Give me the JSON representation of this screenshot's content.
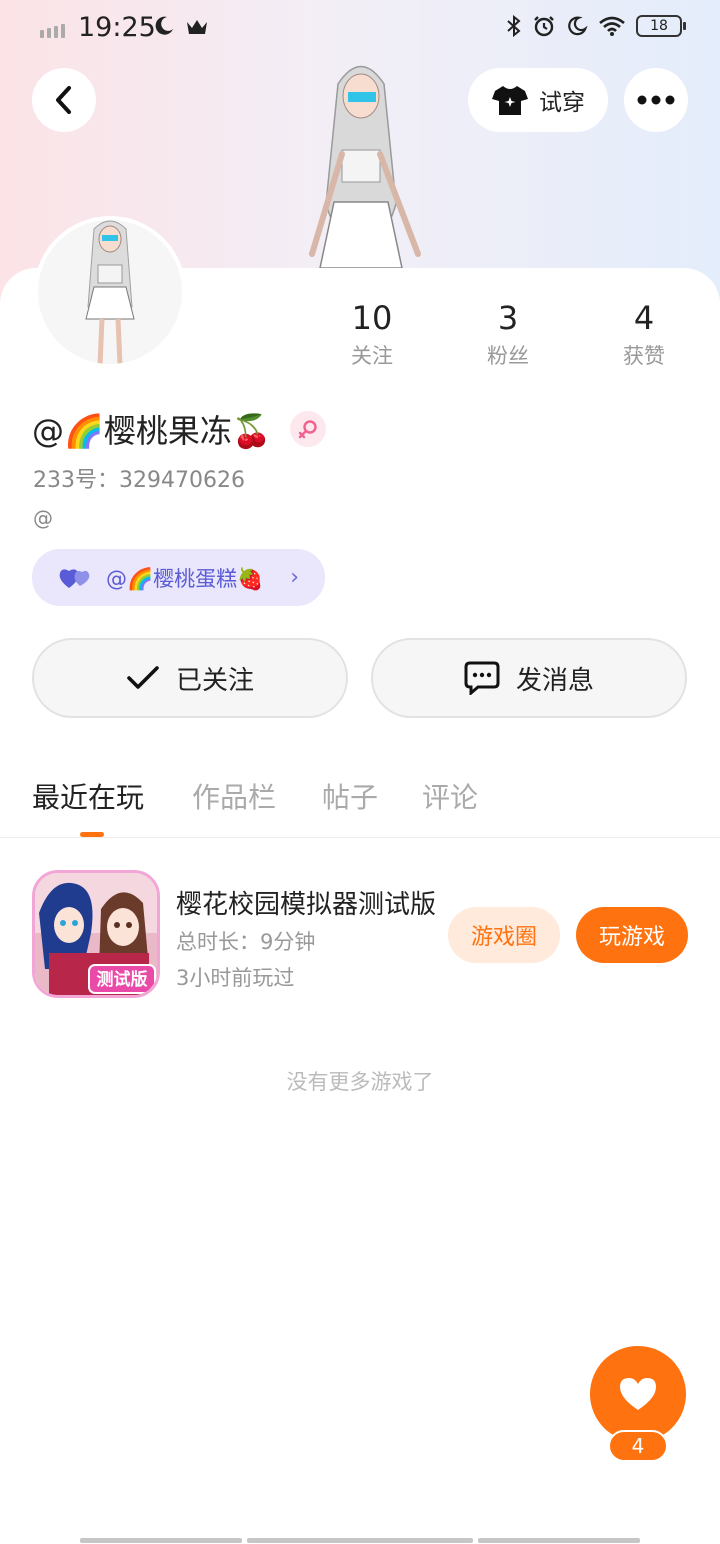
{
  "status_bar": {
    "time": "19:25",
    "battery": "18"
  },
  "header": {
    "tryon_label": "试穿"
  },
  "stats": [
    {
      "value": "10",
      "label": "关注"
    },
    {
      "value": "3",
      "label": "粉丝"
    },
    {
      "value": "4",
      "label": "获赞"
    }
  ],
  "profile": {
    "username": "@🌈樱桃果冻🍒",
    "account_id": "233号：329470626",
    "bio": "@",
    "cp_name": "@🌈樱桃蛋糕🍓"
  },
  "actions": {
    "follow_label": "已关注",
    "message_label": "发消息"
  },
  "tabs": [
    {
      "label": "最近在玩",
      "active": true
    },
    {
      "label": "作品栏",
      "active": false
    },
    {
      "label": "帖子",
      "active": false
    },
    {
      "label": "评论",
      "active": false
    }
  ],
  "games": [
    {
      "title": "樱花校园模拟器测试版",
      "duration": "总时长：9分钟",
      "last_played": "3小时前玩过",
      "icon_badge": "测试版",
      "circle_label": "游戏圈",
      "play_label": "玩游戏"
    }
  ],
  "no_more_text": "没有更多游戏了",
  "like_count": "4",
  "colors": {
    "accent": "#ff7210",
    "cp_pill_bg": "#eae6fb",
    "cp_text": "#5a5bd6"
  }
}
